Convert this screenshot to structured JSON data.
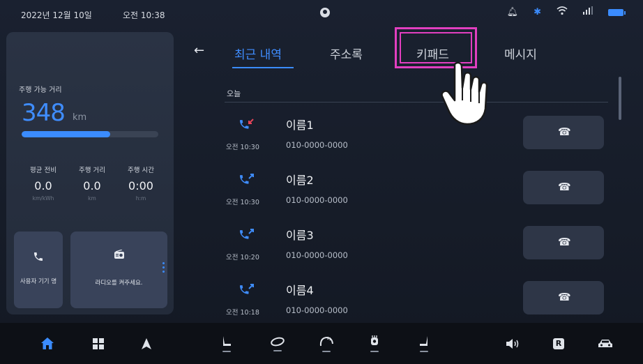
{
  "status_bar": {
    "date": "2022년 12월 10일",
    "time": "오전 10:38",
    "icons": [
      "user-icon",
      "bell-icon",
      "bluetooth-icon",
      "wifi-icon",
      "signal-icon",
      "battery-icon"
    ]
  },
  "left_panel": {
    "range_label": "주행 가능 거리",
    "range_value": "348",
    "range_unit": "km",
    "range_fraction": 0.65,
    "stats": [
      {
        "label": "평균 전비",
        "value": "0.0",
        "unit": "km/kWh"
      },
      {
        "label": "주행 거리",
        "value": "0.0",
        "unit": "km"
      },
      {
        "label": "주행 시간",
        "value": "0:00",
        "unit": "h:m"
      }
    ],
    "phone_card": {
      "text": "사용자 기기 명"
    },
    "radio_card": {
      "text": "라디오를 켜주세요."
    }
  },
  "tabs": {
    "items": [
      "최근 내역",
      "주소록",
      "키패드",
      "메시지"
    ],
    "active": 0,
    "highlighted": "키패드"
  },
  "recent": {
    "section_label": "오늘",
    "calls": [
      {
        "name": "이름1",
        "number": "010-0000-0000",
        "time": "오전 10:30",
        "type": "missed"
      },
      {
        "name": "이름2",
        "number": "010-0000-0000",
        "time": "오전 10:30",
        "type": "outgoing"
      },
      {
        "name": "이름3",
        "number": "010-0000-0000",
        "time": "오전 10:20",
        "type": "outgoing"
      },
      {
        "name": "이름4",
        "number": "010-0000-0000",
        "time": "오전 10:18",
        "type": "outgoing"
      }
    ]
  },
  "dock": {
    "items": [
      "home-icon",
      "apps-grid-icon",
      "navigation-icon",
      "seat-driver-icon",
      "climate-fan-icon",
      "defrost-rear-icon",
      "seat-heat-icon",
      "seat-passenger-icon",
      "volume-icon",
      "rear-camera-icon",
      "car-icon"
    ],
    "camera_label": "R"
  },
  "colors": {
    "accent": "#3b8cff",
    "highlight": "#e23fc0",
    "missed": "#e8455a",
    "background": "#161c28"
  }
}
